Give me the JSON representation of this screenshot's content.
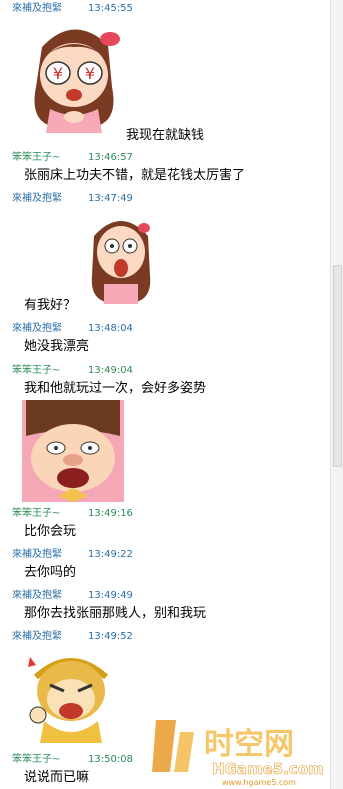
{
  "chat": {
    "messages": [
      {
        "sender": "來補及抱緊",
        "time": "13:45:55",
        "text": "我现在就缺钱",
        "sticker": "yen-eyes-girl-sticker"
      },
      {
        "sender": "笨笨王子~",
        "time": "13:46:57",
        "text": "张丽床上功夫不错，就是花钱太厉害了"
      },
      {
        "sender": "來補及抱緊",
        "time": "13:47:49",
        "text": "有我好？",
        "sticker": "shocked-girl-sticker"
      },
      {
        "sender": "來補及抱緊",
        "time": "13:48:04",
        "text": "她没我漂亮"
      },
      {
        "sender": "笨笨王子~",
        "time": "13:49:04",
        "text": "我和他就玩过一次，会好多姿势",
        "sticker": "crying-boy-sticker"
      },
      {
        "sender": "笨笨王子~",
        "time": "13:49:16",
        "text": "比你会玩"
      },
      {
        "sender": "來補及抱緊",
        "time": "13:49:22",
        "text": "去你吗的"
      },
      {
        "sender": "來補及抱緊",
        "time": "13:49:49",
        "text": "那你去找张丽那贱人，别和我玩"
      },
      {
        "sender": "來補及抱緊",
        "time": "13:49:52",
        "text": "",
        "sticker": "angry-monkey-king-sticker"
      },
      {
        "sender": "笨笨王子~",
        "time": "13:50:08",
        "text": "说说而已嘛"
      }
    ]
  },
  "watermark": {
    "name": "时空网",
    "url": "HGame5.com",
    "sub": "www.hgame5.com"
  },
  "colors": {
    "sender_a": "#2a6fa8",
    "sender_b": "#2d8c57",
    "watermark": "#e79a2a"
  }
}
